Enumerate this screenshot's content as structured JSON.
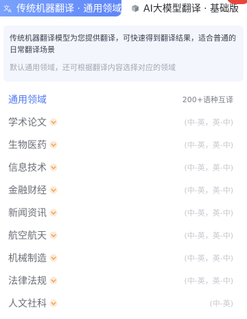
{
  "tabs": {
    "active": {
      "label": "传统机器翻译 · 通用领域",
      "icon": "translate-icon"
    },
    "inactive": {
      "label": "AI大模型翻译 · 基础版",
      "icon": "cube-icon"
    }
  },
  "description": {
    "main": "传统机器翻译模型为您提供翻译，可快速得到翻译结果，适合普通的日常翻译场景",
    "sub": "默认通用领域，还可根据翻译内容选择对应的领域"
  },
  "colors": {
    "accent": "#5f86f7",
    "vip_badge": "#f0a14a",
    "panel_bg": "#f4f6fd"
  },
  "domains": [
    {
      "name": "通用领域",
      "meta": "200+语种互译",
      "selected": true,
      "vip": false
    },
    {
      "name": "学术论文",
      "meta": "(中-英，英-中)",
      "selected": false,
      "vip": true
    },
    {
      "name": "生物医药",
      "meta": "(中-英，英-中)",
      "selected": false,
      "vip": true
    },
    {
      "name": "信息技术",
      "meta": "(中-英，英-中)",
      "selected": false,
      "vip": true
    },
    {
      "name": "金融财经",
      "meta": "(中-英，英-中)",
      "selected": false,
      "vip": true
    },
    {
      "name": "新闻资讯",
      "meta": "(中-英，英-中)",
      "selected": false,
      "vip": true
    },
    {
      "name": "航空航天",
      "meta": "(中-英，英-中)",
      "selected": false,
      "vip": true
    },
    {
      "name": "机械制造",
      "meta": "(中-英，英-中)",
      "selected": false,
      "vip": true
    },
    {
      "name": "法律法规",
      "meta": "(中-英，英-中)",
      "selected": false,
      "vip": true
    },
    {
      "name": "人文社科",
      "meta": "(中-英)",
      "selected": false,
      "vip": true
    }
  ]
}
